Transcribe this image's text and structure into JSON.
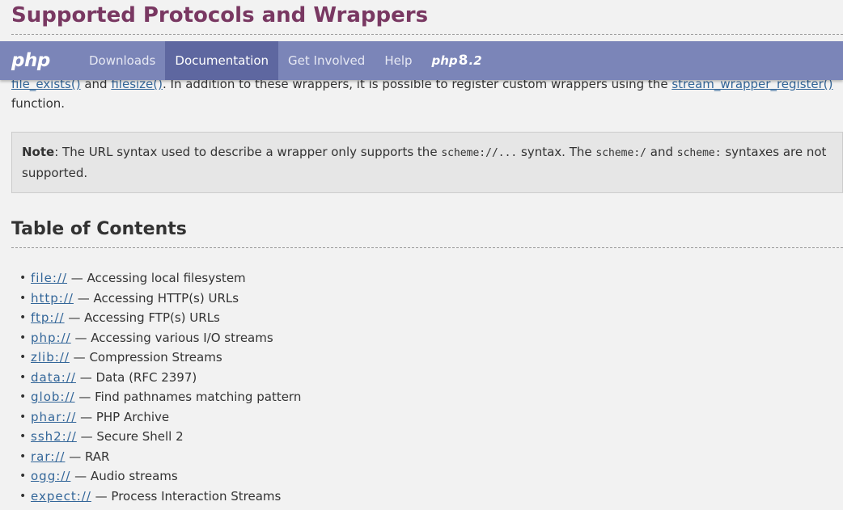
{
  "page": {
    "title": "Supported Protocols and Wrappers"
  },
  "nav": {
    "logo": "php",
    "items": [
      "Downloads",
      "Documentation",
      "Get Involved",
      "Help"
    ],
    "php8_logo": {
      "prefix": "php",
      "mid": "8",
      "suffix": ".2"
    }
  },
  "intro": {
    "link1": "file_exists()",
    "and": " and ",
    "link2": "filesize()",
    "text": ". In addition to these wrappers, it is possible to register custom wrappers using the ",
    "link3": "stream_wrapper_register()",
    "line2": "function."
  },
  "note": {
    "label": "Note",
    "text1": ": The URL syntax used to describe a wrapper only supports the ",
    "code1": "scheme://...",
    "text2": " syntax. The ",
    "code2": "scheme:/",
    "text3": " and ",
    "code3": "scheme:",
    "text4": " syntaxes are not supported."
  },
  "toc": {
    "title": "Table of Contents",
    "items": [
      {
        "link": "file://",
        "desc": " — Accessing local filesystem"
      },
      {
        "link": "http://",
        "desc": " — Accessing HTTP(s) URLs"
      },
      {
        "link": "ftp://",
        "desc": " — Accessing FTP(s) URLs"
      },
      {
        "link": "php://",
        "desc": " — Accessing various I/O streams"
      },
      {
        "link": "zlib://",
        "desc": " — Compression Streams"
      },
      {
        "link": "data://",
        "desc": " — Data (RFC 2397)"
      },
      {
        "link": "glob://",
        "desc": " — Find pathnames matching pattern"
      },
      {
        "link": "phar://",
        "desc": " — PHP Archive"
      },
      {
        "link": "ssh2://",
        "desc": " — Secure Shell 2"
      },
      {
        "link": "rar://",
        "desc": " — RAR"
      },
      {
        "link": "ogg://",
        "desc": " — Audio streams"
      },
      {
        "link": "expect://",
        "desc": " — Process Interaction Streams"
      }
    ]
  }
}
